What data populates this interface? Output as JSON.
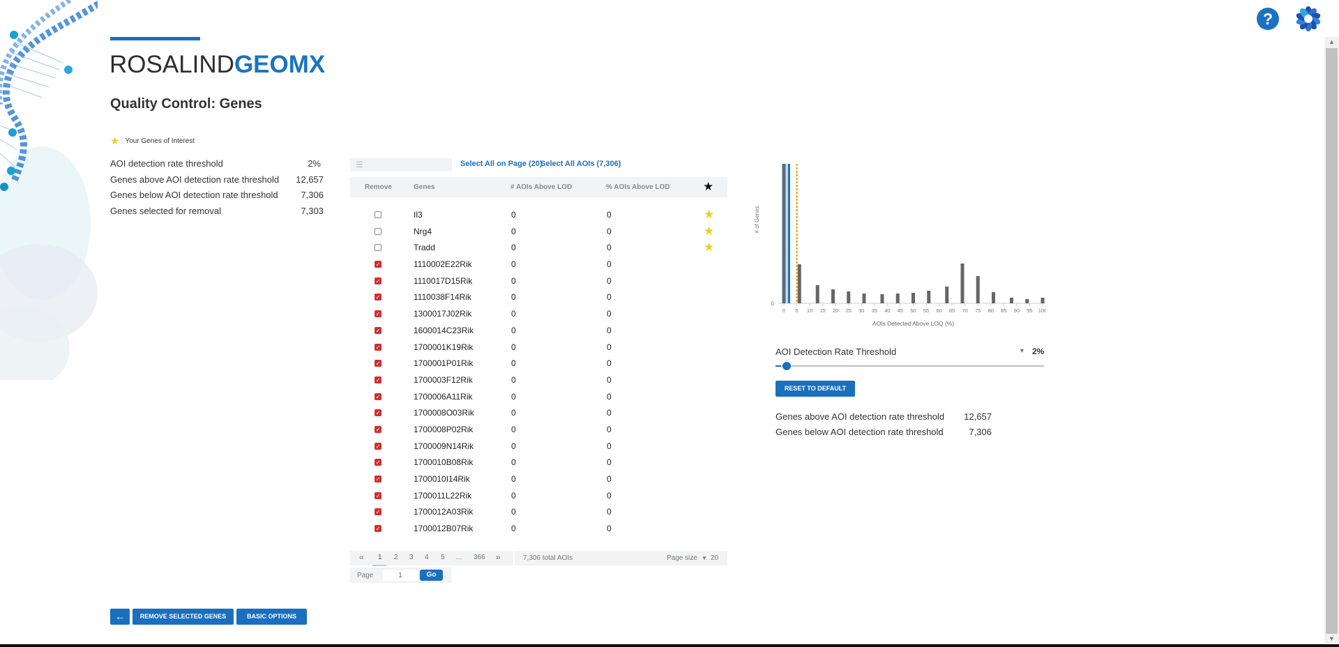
{
  "brand": {
    "part1": "ROSALIND",
    "part2": "GEOMX"
  },
  "header": {
    "help_icon": "?",
    "title": "Quality Control: Genes"
  },
  "legend": {
    "label": "Your Genes of Interest",
    "icon": "star-icon"
  },
  "stats": [
    {
      "label": "AOI detection rate threshold",
      "value": "2%"
    },
    {
      "label": "Genes above AOI detection rate threshold",
      "value": "12,657"
    },
    {
      "label": "Genes below AOI detection rate threshold",
      "value": "7,306"
    },
    {
      "label": "Genes selected for removal",
      "value": "7,303"
    }
  ],
  "table": {
    "filter_placeholder": "",
    "select_all_page": "Select All on Page (20)",
    "select_all_aois": "Select All AOIs (7,306)",
    "columns": [
      "Remove",
      "Genes",
      "# AOIs Above LOD",
      "% AOIs Above LOD",
      "★"
    ],
    "rows": [
      {
        "checked": false,
        "gene": "Il3",
        "count": "0",
        "pct": "0",
        "star": true
      },
      {
        "checked": false,
        "gene": "Nrg4",
        "count": "0",
        "pct": "0",
        "star": true
      },
      {
        "checked": false,
        "gene": "Tradd",
        "count": "0",
        "pct": "0",
        "star": true
      },
      {
        "checked": true,
        "gene": "1110002E22Rik",
        "count": "0",
        "pct": "0",
        "star": false
      },
      {
        "checked": true,
        "gene": "1110017D15Rik",
        "count": "0",
        "pct": "0",
        "star": false
      },
      {
        "checked": true,
        "gene": "1110038F14Rik",
        "count": "0",
        "pct": "0",
        "star": false
      },
      {
        "checked": true,
        "gene": "1300017J02Rik",
        "count": "0",
        "pct": "0",
        "star": false
      },
      {
        "checked": true,
        "gene": "1600014C23Rik",
        "count": "0",
        "pct": "0",
        "star": false
      },
      {
        "checked": true,
        "gene": "1700001K19Rik",
        "count": "0",
        "pct": "0",
        "star": false
      },
      {
        "checked": true,
        "gene": "1700001P01Rik",
        "count": "0",
        "pct": "0",
        "star": false
      },
      {
        "checked": true,
        "gene": "1700003F12Rik",
        "count": "0",
        "pct": "0",
        "star": false
      },
      {
        "checked": true,
        "gene": "1700006A11Rik",
        "count": "0",
        "pct": "0",
        "star": false
      },
      {
        "checked": true,
        "gene": "1700008O03Rik",
        "count": "0",
        "pct": "0",
        "star": false
      },
      {
        "checked": true,
        "gene": "1700008P02Rik",
        "count": "0",
        "pct": "0",
        "star": false
      },
      {
        "checked": true,
        "gene": "1700009N14Rik",
        "count": "0",
        "pct": "0",
        "star": false
      },
      {
        "checked": true,
        "gene": "1700010B08Rik",
        "count": "0",
        "pct": "0",
        "star": false
      },
      {
        "checked": true,
        "gene": "1700010I14Rik",
        "count": "0",
        "pct": "0",
        "star": false
      },
      {
        "checked": true,
        "gene": "1700011L22Rik",
        "count": "0",
        "pct": "0",
        "star": false
      },
      {
        "checked": true,
        "gene": "1700012A03Rik",
        "count": "0",
        "pct": "0",
        "star": false
      },
      {
        "checked": true,
        "gene": "1700012B07Rik",
        "count": "0",
        "pct": "0",
        "star": false
      }
    ]
  },
  "pagination": {
    "first": "«",
    "pages": [
      "1",
      "2",
      "3",
      "4",
      "5",
      "...",
      "366"
    ],
    "last": "»",
    "current": "1",
    "total": "7,306 total AOIs",
    "page_size_label": "Page size",
    "page_size": "20",
    "goto_label": "Page",
    "goto_value": "1",
    "go_label": "Go"
  },
  "chart_data": {
    "type": "bar",
    "title": "",
    "xlabel": "AOIs Detected Above LOQ (%)",
    "ylabel": "# of Genes",
    "x_ticks": [
      0,
      5,
      10,
      15,
      20,
      25,
      30,
      35,
      40,
      45,
      50,
      55,
      60,
      65,
      70,
      75,
      80,
      85,
      90,
      95,
      100
    ],
    "y_ticks": [
      0
    ],
    "xlim": [
      0,
      100
    ],
    "bars": [
      {
        "x": 0,
        "value": 100
      },
      {
        "x": 6,
        "value": 28
      },
      {
        "x": 13,
        "value": 13
      },
      {
        "x": 19,
        "value": 10
      },
      {
        "x": 25,
        "value": 8.5
      },
      {
        "x": 31,
        "value": 7
      },
      {
        "x": 38,
        "value": 6.5
      },
      {
        "x": 44,
        "value": 7
      },
      {
        "x": 50,
        "value": 7.5
      },
      {
        "x": 56,
        "value": 9
      },
      {
        "x": 63,
        "value": 12
      },
      {
        "x": 69,
        "value": 28.5
      },
      {
        "x": 75,
        "value": 19.5
      },
      {
        "x": 81,
        "value": 8
      },
      {
        "x": 88,
        "value": 4
      },
      {
        "x": 94,
        "value": 3
      },
      {
        "x": 100,
        "value": 4
      }
    ],
    "threshold_line": {
      "x": 2,
      "color": "#1a6fbe"
    },
    "default_line": {
      "x": 5,
      "color": "#f5a623",
      "style": "dashed"
    },
    "notes": "Bar at 0% is clipped (exceeds visible range)."
  },
  "threshold": {
    "label": "AOI Detection Rate Threshold",
    "value": "2%",
    "slider_percent": 2,
    "reset_label": "RESET TO DEFAULT"
  },
  "right_stats": [
    {
      "label": "Genes above AOI detection rate threshold",
      "value": "12,657"
    },
    {
      "label": "Genes below AOI detection rate threshold",
      "value": "7,306"
    }
  ],
  "footer": {
    "back_icon": "arrow-left-icon",
    "remove_label": "REMOVE SELECTED GENES",
    "basic_label": "BASIC OPTIONS"
  },
  "colors": {
    "accent": "#1a6fbe",
    "check": "#d32f2f",
    "star": "#e8d21a",
    "default_line": "#f5a623"
  }
}
